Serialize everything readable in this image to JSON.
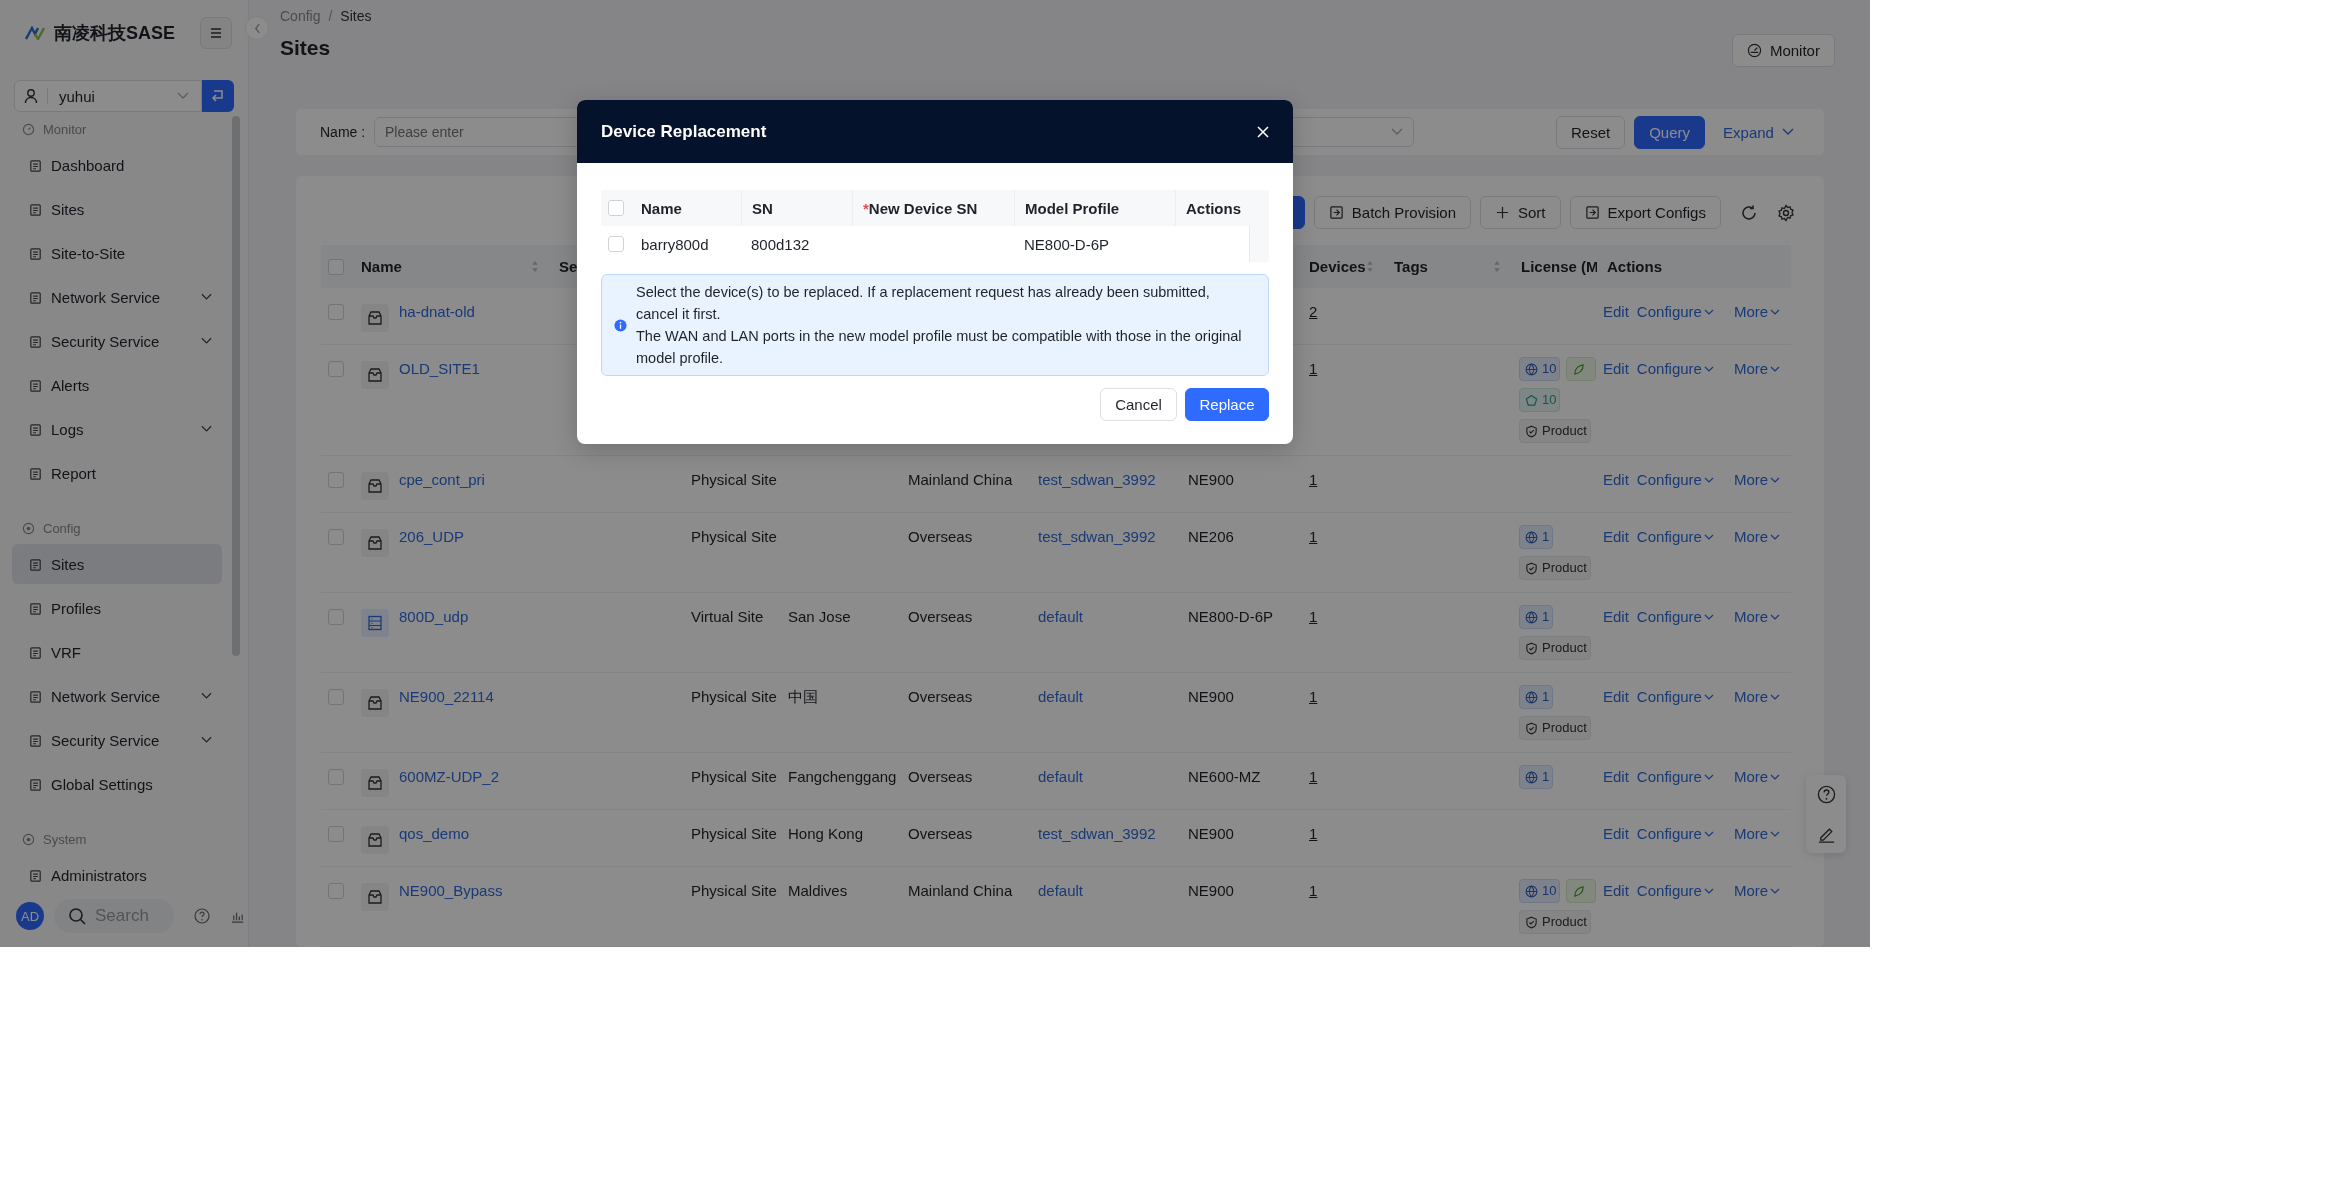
{
  "sidebar": {
    "brand": "南凌科技SASE",
    "user": "yuhui",
    "sections": [
      {
        "title": "Monitor",
        "items": [
          {
            "label": "Dashboard",
            "selected": false
          },
          {
            "label": "Sites",
            "selected": false
          },
          {
            "label": "Site-to-Site",
            "selected": false
          },
          {
            "label": "Network Service",
            "selected": false,
            "expanded": false
          },
          {
            "label": "Security Service",
            "selected": false,
            "expanded": false
          },
          {
            "label": "Alerts",
            "selected": false
          },
          {
            "label": "Logs",
            "selected": false,
            "expanded": false
          },
          {
            "label": "Report",
            "selected": false
          }
        ]
      },
      {
        "title": "Config",
        "items": [
          {
            "label": "Sites",
            "selected": true
          },
          {
            "label": "Profiles",
            "selected": false
          },
          {
            "label": "VRF",
            "selected": false
          },
          {
            "label": "Network Service",
            "selected": false,
            "expanded": false
          },
          {
            "label": "Security Service",
            "selected": false,
            "expanded": false
          },
          {
            "label": "Global Settings",
            "selected": false
          }
        ]
      },
      {
        "title": "System",
        "items": [
          {
            "label": "Administrators",
            "selected": false
          }
        ]
      }
    ],
    "avatar": "AD",
    "search": "Search"
  },
  "breadcrumb": {
    "items": [
      "Config",
      "Sites"
    ],
    "separator": "/"
  },
  "title": "Sites",
  "monitor_button": "Monitor",
  "filters": {
    "name_label": "Name :",
    "placeholder": "Please enter",
    "reset": "Reset",
    "query": "Query",
    "expand": "Expand"
  },
  "toolbar": [
    "Batch Provision",
    "Sort",
    "Export Configs"
  ],
  "table": {
    "all_checked": false,
    "columns": [
      {
        "label": "Name",
        "sortable": true
      },
      {
        "label": "Se"
      },
      {
        "label": "Devices",
        "sortable": true
      },
      {
        "label": "Tags",
        "sortable": true
      },
      {
        "label": "License (M"
      },
      {
        "label": "Actions",
        "sortable": false
      }
    ],
    "rows": [
      {
        "checked": false,
        "kind": "physical",
        "name": "ha-dnat-old",
        "devices": "2",
        "license": [],
        "actions": [
          "Edit",
          "Configure",
          "More"
        ]
      },
      {
        "checked": false,
        "kind": "physical",
        "name": "OLD_SITE1",
        "devices": "1",
        "license": [
          {
            "kind": "bandwidth",
            "text": "10"
          },
          {
            "kind": "app"
          },
          {
            "kind": "security",
            "text": "10"
          },
          {
            "kind": "product",
            "text": "Product"
          }
        ],
        "actions": [
          "Edit",
          "Configure",
          "More"
        ]
      },
      {
        "checked": false,
        "kind": "physical",
        "name": "cpe_cont_pri",
        "site_type": "Physical Site",
        "region": "Mainland China",
        "profile": "test_sdwan_3992",
        "model": "NE900",
        "devices": "1",
        "license": [],
        "actions": [
          "Edit",
          "Configure",
          "More"
        ]
      },
      {
        "checked": false,
        "kind": "physical",
        "name": "206_UDP",
        "site_type": "Physical Site",
        "region": "Overseas",
        "profile": "test_sdwan_3992",
        "model": "NE206",
        "devices": "1",
        "license": [
          {
            "kind": "bandwidth",
            "text": "1"
          },
          {
            "kind": "product",
            "text": "Product"
          }
        ],
        "actions": [
          "Edit",
          "Configure",
          "More"
        ]
      },
      {
        "checked": false,
        "kind": "virtual",
        "name": "800D_udp",
        "site_type": "Virtual Site",
        "city": "San Jose",
        "region": "Overseas",
        "profile": "default",
        "model": "NE800-D-6P",
        "devices": "1",
        "license": [
          {
            "kind": "bandwidth",
            "text": "1"
          },
          {
            "kind": "product",
            "text": "Product"
          }
        ],
        "actions": [
          "Edit",
          "Configure",
          "More"
        ]
      },
      {
        "checked": false,
        "kind": "physical",
        "name": "NE900_22114",
        "site_type": "Physical Site",
        "city": "中国",
        "region": "Overseas",
        "profile": "default",
        "model": "NE900",
        "devices": "1",
        "license": [
          {
            "kind": "bandwidth",
            "text": "1"
          },
          {
            "kind": "product",
            "text": "Product"
          }
        ],
        "actions": [
          "Edit",
          "Configure",
          "More"
        ]
      },
      {
        "checked": false,
        "kind": "physical",
        "name": "600MZ-UDP_2",
        "site_type": "Physical Site",
        "city": "Fangchenggang",
        "region": "Overseas",
        "profile": "default",
        "model": "NE600-MZ",
        "devices": "1",
        "license": [
          {
            "kind": "bandwidth",
            "text": "1"
          }
        ],
        "actions": [
          "Edit",
          "Configure",
          "More"
        ]
      },
      {
        "checked": false,
        "kind": "physical",
        "name": "qos_demo",
        "site_type": "Physical Site",
        "city": "Hong Kong",
        "region": "Overseas",
        "profile": "test_sdwan_3992",
        "model": "NE900",
        "devices": "1",
        "license": [],
        "actions": [
          "Edit",
          "Configure",
          "More"
        ]
      },
      {
        "checked": false,
        "kind": "physical",
        "name": "NE900_Bypass",
        "site_type": "Physical Site",
        "city": "Maldives",
        "region": "Mainland China",
        "profile": "default",
        "model": "NE900",
        "devices": "1",
        "license": [
          {
            "kind": "bandwidth",
            "text": "10"
          },
          {
            "kind": "app"
          },
          {
            "kind": "product",
            "text": "Product"
          }
        ],
        "actions": [
          "Edit",
          "Configure",
          "More"
        ]
      }
    ]
  },
  "modal": {
    "title": "Device Replacement",
    "all_checked": false,
    "columns": [
      {
        "label": "Name"
      },
      {
        "label": "SN"
      },
      {
        "label": "New Device SN",
        "required_mark": "*"
      },
      {
        "label": "Model Profile"
      },
      {
        "label": "Actions"
      }
    ],
    "rows": [
      {
        "checked": false,
        "name": "barry800d",
        "sn": "800d132",
        "model_profile": "NE800-D-6P"
      }
    ],
    "notice": [
      "Select the device(s) to be replaced. If a replacement request has already been submitted, cancel it first.",
      "The WAN and LAN ports in the new model profile must be compatible with those in the original model profile."
    ],
    "cancel": "Cancel",
    "confirm": "Replace"
  }
}
